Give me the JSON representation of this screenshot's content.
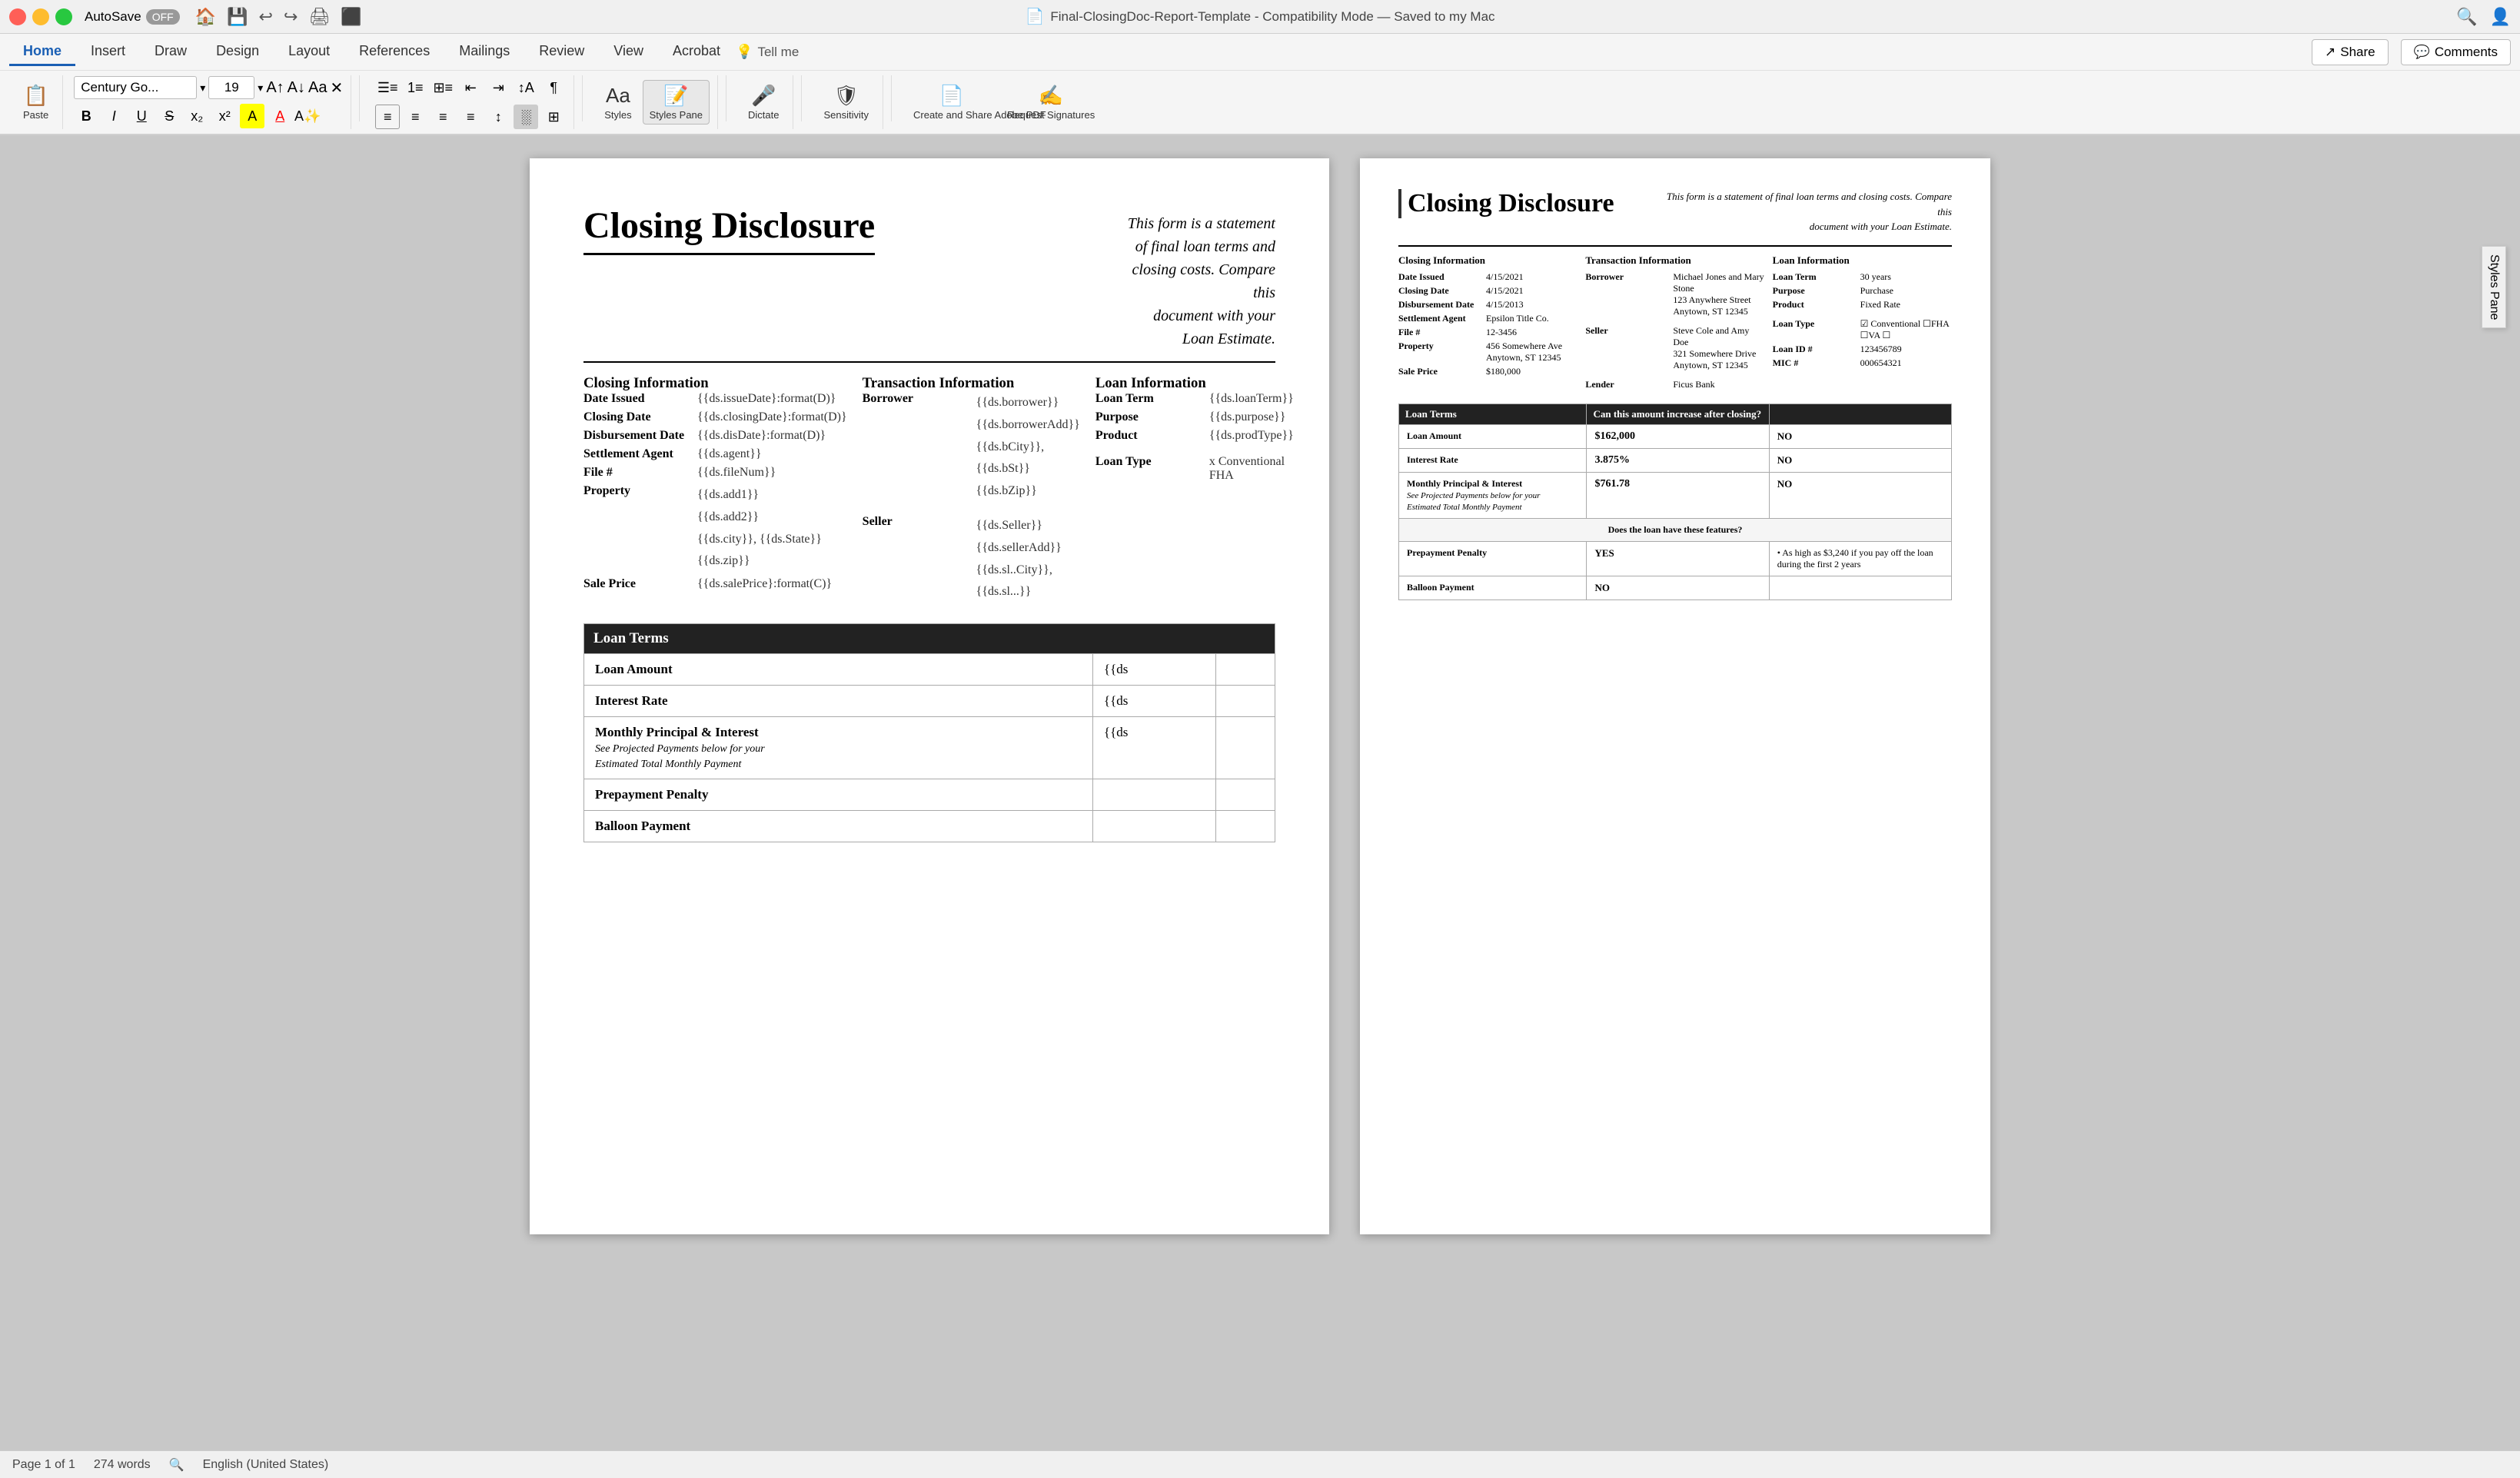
{
  "titleBar": {
    "autoSave": "AutoSave",
    "autoSaveState": "OFF",
    "title": "Final-ClosingDoc-Report-Template  -  Compatibility Mode  —  Saved to my Mac",
    "icons": [
      "home",
      "save",
      "undo",
      "redo",
      "print",
      "share-screen"
    ]
  },
  "tabs": {
    "items": [
      "Home",
      "Insert",
      "Draw",
      "Design",
      "Layout",
      "References",
      "Mailings",
      "Review",
      "View",
      "Acrobat"
    ],
    "active": "Home",
    "tell_me": "Tell me",
    "share": "Share",
    "comments": "Comments"
  },
  "ribbon": {
    "paste": "Paste",
    "font_name": "Century Go...",
    "font_size": "19",
    "bold": "B",
    "italic": "I",
    "underline": "U",
    "styles": "Styles",
    "styles_pane": "Styles Pane",
    "dictate": "Dictate",
    "sensitivity": "Sensitivity",
    "create_share_pdf": "Create and Share Adobe PDF",
    "request_signatures": "Request Signatures"
  },
  "document": {
    "page1": {
      "title": "Closing Disclosure",
      "subtitle": "This form is a statement of final loan terms and closing costs. Compare this\ndocument with your Loan Estimate.",
      "closing_info": {
        "title": "Closing Information",
        "rows": [
          {
            "label": "Date Issued",
            "value": "{{ds.issueDate}:format(D)}"
          },
          {
            "label": "Closing Date",
            "value": "{{ds.closingDate}:format(D)}"
          },
          {
            "label": "Disbursement Date",
            "value": "{{ds.disDate}:format(D)}"
          },
          {
            "label": "Settlement Agent",
            "value": "{{ds.agent}}"
          },
          {
            "label": "File #",
            "value": "{{ds.fileNum}}"
          },
          {
            "label": "Property",
            "value": "{{ds.add1}}\n{{ds.add2}}\n{{ds.city}}, {{ds.State}}\n{{ds.zip}}"
          },
          {
            "label": "Sale Price",
            "value": "{{ds.salePrice}:format(C)}"
          }
        ]
      },
      "transaction_info": {
        "title": "Transaction  Information",
        "borrower_label": "Borrower",
        "borrower_value": "{{ds.borrower}}\n{{ds.borrowerAdd}}\n{{ds.bCity}}, {{ds.bSt}} {{ds.bZip}}",
        "seller_label": "Seller",
        "seller_value": "{{ds.Seller}}\n{{ds.sellerAdd}}\n{{ds.sl..City}}, {{ds.sl...}}"
      },
      "loan_info": {
        "title": "Loan  Information",
        "rows": [
          {
            "label": "Loan Term",
            "value": "{{ds.loanTerm}}"
          },
          {
            "label": "Purpose",
            "value": "{{ds.purpose}}"
          },
          {
            "label": "Product",
            "value": "{{ds.prodType}}"
          }
        ],
        "loan_type_label": "Loan Type",
        "loan_type_value": "x  Conventional     FHA"
      },
      "loan_terms": {
        "header": "Loan Terms",
        "rows": [
          {
            "label": "Loan Amount",
            "value": "{{ds"
          },
          {
            "label": "Interest Rate",
            "value": "{{ds"
          },
          {
            "label": "Monthly Principal & Interest",
            "value": "{{ds",
            "sub": "See Projected Payments below for your\nEstimated Total Monthly Payment"
          },
          {
            "label": "Prepayment Penalty",
            "value": ""
          },
          {
            "label": "Balloon Payment",
            "value": ""
          }
        ]
      }
    },
    "page2": {
      "title": "Closing Disclosure",
      "subtitle": "This form is a statement of final loan terms and closing costs. Compare this\ndocument with your Loan Estimate.",
      "closing_info": {
        "title": "Closing Information",
        "rows": [
          {
            "label": "Date Issued",
            "value": "4/15/2021"
          },
          {
            "label": "Closing Date",
            "value": "4/15/2021"
          },
          {
            "label": "Disbursement Date",
            "value": "4/15/2013"
          },
          {
            "label": "Settlement Agent",
            "value": "Epsilon Title Co."
          },
          {
            "label": "File #",
            "value": "12-3456"
          },
          {
            "label": "Property",
            "value": "456 Somewhere  Ave\nAnytown, ST 12345"
          },
          {
            "label": "Sale Price",
            "value": "$180,000"
          }
        ]
      },
      "transaction_info": {
        "title": "Transaction  Information",
        "borrower_label": "Borrower",
        "borrower_value": "Michael Jones and Mary Stone\n123 Anywhere Street\nAnytown, ST 12345",
        "seller_label": "Seller",
        "seller_value": "Steve Cole and Amy Doe\n321 Somewhere Drive\nAnytown, ST 12345",
        "lender_label": "Lender",
        "lender_value": "Ficus Bank"
      },
      "loan_info": {
        "title": "Loan  Information",
        "rows": [
          {
            "label": "Loan Term",
            "value": "30 years"
          },
          {
            "label": "Purpose",
            "value": "Purchase"
          },
          {
            "label": "Product",
            "value": "Fixed Rate"
          }
        ],
        "loan_type_label": "Loan Type",
        "loan_type_value": "☑ Conventional  ☐FHA\n☐VA  ☐",
        "loan_id_label": "Loan ID #",
        "loan_id_value": "123456789",
        "mic_label": "MIC #",
        "mic_value": "000654321"
      },
      "loan_terms": {
        "header": "Loan Terms",
        "can_increase": "Can this amount increase after closing?",
        "rows": [
          {
            "label": "Loan Amount",
            "value": "$162,000",
            "answer": "NO"
          },
          {
            "label": "Interest Rate",
            "value": "3.875%",
            "answer": "NO"
          },
          {
            "label": "Monthly Principal & Interest",
            "value": "$761.78",
            "answer": "NO",
            "sub": "See Projected Payments below for your\nEstimated Total Monthly Payment"
          }
        ],
        "features_header": "Does the loan have these features?",
        "feature_rows": [
          {
            "label": "Prepayment Penalty",
            "answer": "YES",
            "detail": "• As high as $3,240 if you pay off the loan during the first 2 years"
          },
          {
            "label": "Balloon Payment",
            "answer": "NO",
            "detail": ""
          }
        ]
      }
    }
  },
  "stylesPane": {
    "title": "Styles Pane"
  },
  "statusBar": {
    "page": "Page 1 of 1",
    "words": "274 words",
    "language": "English (United States)"
  }
}
